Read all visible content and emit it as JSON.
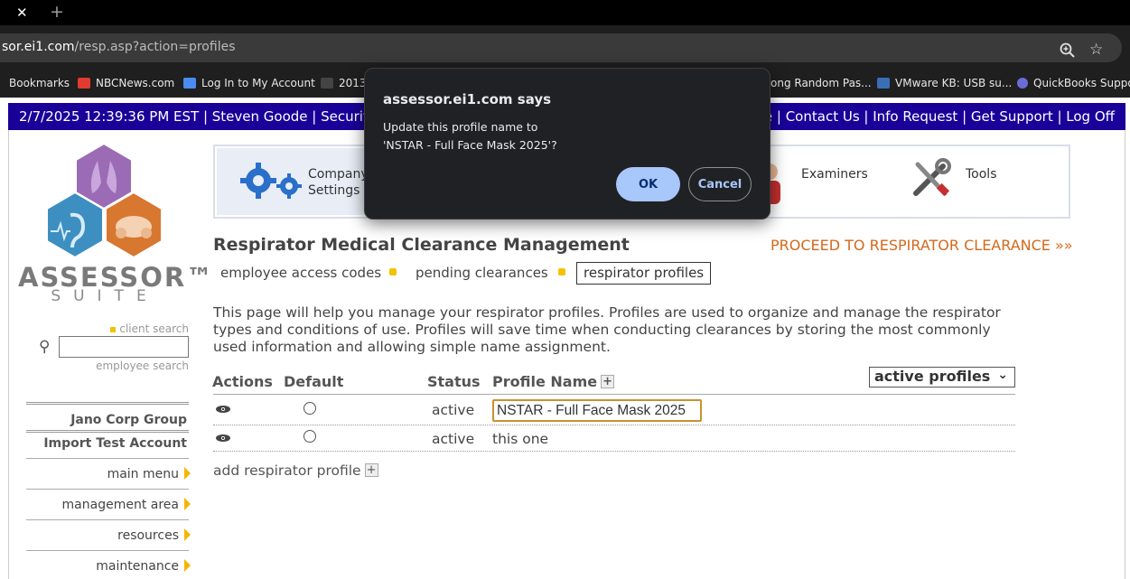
{
  "browser": {
    "url_host": "sor.ei1.com",
    "url_path": "/resp.asp?action=profiles",
    "bookmarks": [
      {
        "label": "Bookmarks",
        "color": "#1f1f1f"
      },
      {
        "label": "NBCNews.com",
        "color": "#e03b2f"
      },
      {
        "label": "Log In to My Account",
        "color": "#4a8df0"
      },
      {
        "label": "2013",
        "color": "#444444"
      },
      {
        "label": "ong Random Pas...",
        "color": "#1f1f1f"
      },
      {
        "label": "VMware KB: USB su...",
        "color": "#3a6fb5"
      },
      {
        "label": "QuickBooks Suppor",
        "color": "#6b6bd8"
      }
    ]
  },
  "topbar": {
    "left": "2/7/2025 12:39:36 PM EST | Steven Goode | Security",
    "right": "me | Contact Us | Info Request | Get Support | Log Off"
  },
  "sidebar": {
    "logo_text": "ASSESSOR™",
    "logo_sub": "SUITE",
    "client_search": "client search",
    "employee_search": "employee search",
    "accounts": [
      "Jano Corp Group",
      "Import Test Account"
    ],
    "menu": [
      "main menu",
      "management area",
      "resources",
      "maintenance"
    ]
  },
  "tools": {
    "company": "Company\nSettings",
    "examiners": "Examiners",
    "tools": "Tools"
  },
  "main": {
    "title": "Respirator Medical Clearance Management",
    "proceed": "PROCEED TO RESPIRATOR CLEARANCE »»",
    "subnav": [
      "employee access codes",
      "pending clearances",
      "respirator profiles"
    ],
    "description": "This page will help you manage your respirator profiles. Profiles are used to organize and manage the respirator types and conditions of use. Profiles will save time when conducting clearances by storing the most commonly used information and allowing simple name assignment.",
    "columns": [
      "Actions",
      "Default",
      "Status",
      "Profile Name"
    ],
    "filter": "active profiles",
    "rows": [
      {
        "status": "active",
        "name": "NSTAR - Full Face Mask 2025"
      },
      {
        "status": "active",
        "name": "this one"
      }
    ],
    "add_label": "add respirator profile"
  },
  "dialog": {
    "title": "assessor.ei1.com says",
    "line1": "Update this profile name to",
    "line2": "'NSTAR - Full Face Mask 2025'?",
    "ok": "OK",
    "cancel": "Cancel"
  }
}
